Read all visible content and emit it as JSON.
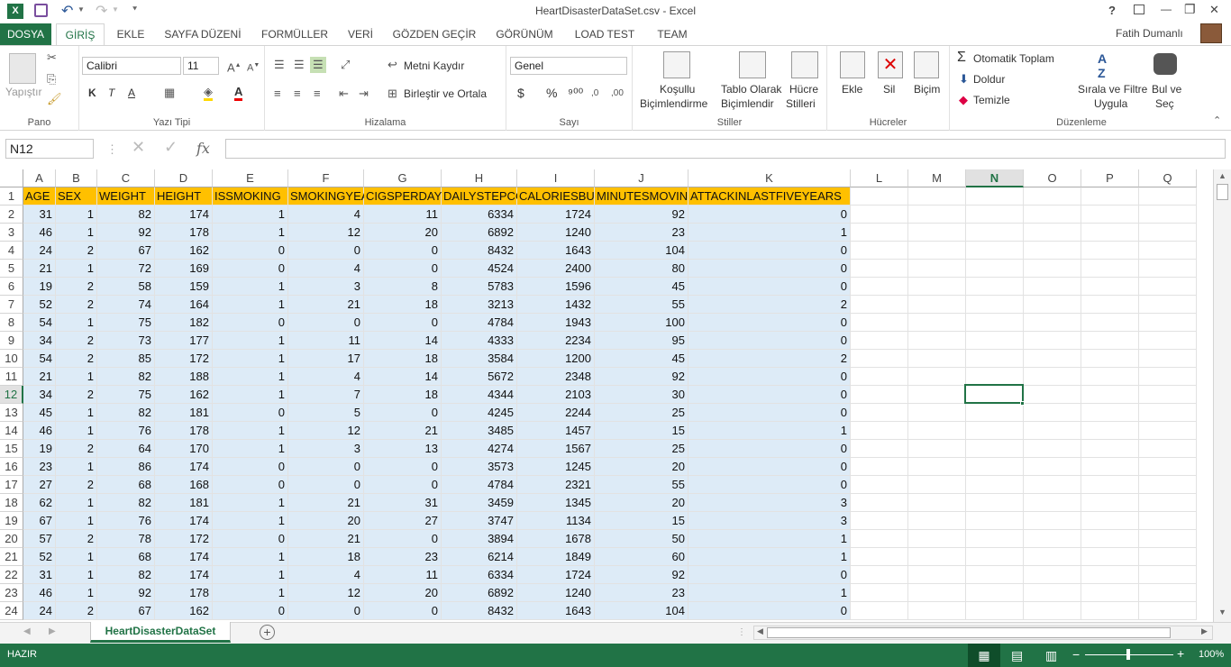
{
  "titlebar": {
    "title": "HeartDisasterDataSet.csv - Excel",
    "help": "?",
    "minimize": "—",
    "restore": "❐",
    "close": "✕"
  },
  "ribbon_tabs": [
    "DOSYA",
    "GİRİŞ",
    "EKLE",
    "SAYFA DÜZENİ",
    "FORMÜLLER",
    "VERİ",
    "GÖZDEN GEÇİR",
    "GÖRÜNÜM",
    "LOAD TEST",
    "TEAM"
  ],
  "user": {
    "name": "Fatih Dumanlı"
  },
  "ribbon": {
    "clipboard": {
      "label": "Pano",
      "paste": "Yapıştır"
    },
    "font": {
      "label": "Yazı Tipi",
      "name": "Calibri",
      "size": "11",
      "bold": "K",
      "italic": "T",
      "underline": "A"
    },
    "alignment": {
      "label": "Hizalama",
      "wrap": "Metni Kaydır",
      "merge": "Birleştir ve Ortala"
    },
    "number": {
      "label": "Sayı",
      "format": "Genel",
      "currency": "$",
      "percent": "%",
      "comma": "⁹⁰⁰"
    },
    "styles": {
      "label": "Stiller",
      "cond1": "Koşullu",
      "cond2": "Biçimlendirme",
      "table1": "Tablo Olarak",
      "table2": "Biçimlendir",
      "cell1": "Hücre",
      "cell2": "Stilleri"
    },
    "cells": {
      "label": "Hücreler",
      "insert": "Ekle",
      "delete": "Sil",
      "format": "Biçim"
    },
    "editing": {
      "label": "Düzenleme",
      "autosum": "Otomatik Toplam",
      "fill": "Doldur",
      "clear": "Temizle",
      "sort1": "Sırala ve Filtre",
      "sort2": "Uygula",
      "find1": "Bul ve",
      "find2": "Seç"
    }
  },
  "formula_bar": {
    "name_box": "N12",
    "fx": "fx",
    "value": ""
  },
  "columns": [
    "A",
    "B",
    "C",
    "D",
    "E",
    "F",
    "G",
    "H",
    "I",
    "J",
    "K",
    "L",
    "M",
    "N",
    "O",
    "P",
    "Q"
  ],
  "selected_column": "N",
  "selected_row": "12",
  "headers": [
    "AGE",
    "SEX",
    "WEIGHT",
    "HEIGHT",
    "ISSMOKING",
    "SMOKINGYEA",
    "CIGSPERDAY",
    "DAILYSTEPCC",
    "CALORIESBUR",
    "MINUTESMOVIN",
    "ATTACKINLASTFIVEYEARS"
  ],
  "rows": [
    [
      "31",
      "1",
      "82",
      "174",
      "1",
      "4",
      "11",
      "6334",
      "1724",
      "92",
      "0"
    ],
    [
      "46",
      "1",
      "92",
      "178",
      "1",
      "12",
      "20",
      "6892",
      "1240",
      "23",
      "1"
    ],
    [
      "24",
      "2",
      "67",
      "162",
      "0",
      "0",
      "0",
      "8432",
      "1643",
      "104",
      "0"
    ],
    [
      "21",
      "1",
      "72",
      "169",
      "0",
      "4",
      "0",
      "4524",
      "2400",
      "80",
      "0"
    ],
    [
      "19",
      "2",
      "58",
      "159",
      "1",
      "3",
      "8",
      "5783",
      "1596",
      "45",
      "0"
    ],
    [
      "52",
      "2",
      "74",
      "164",
      "1",
      "21",
      "18",
      "3213",
      "1432",
      "55",
      "2"
    ],
    [
      "54",
      "1",
      "75",
      "182",
      "0",
      "0",
      "0",
      "4784",
      "1943",
      "100",
      "0"
    ],
    [
      "34",
      "2",
      "73",
      "177",
      "1",
      "11",
      "14",
      "4333",
      "2234",
      "95",
      "0"
    ],
    [
      "54",
      "2",
      "85",
      "172",
      "1",
      "17",
      "18",
      "3584",
      "1200",
      "45",
      "2"
    ],
    [
      "21",
      "1",
      "82",
      "188",
      "1",
      "4",
      "14",
      "5672",
      "2348",
      "92",
      "0"
    ],
    [
      "34",
      "2",
      "75",
      "162",
      "1",
      "7",
      "18",
      "4344",
      "2103",
      "30",
      "0"
    ],
    [
      "45",
      "1",
      "82",
      "181",
      "0",
      "5",
      "0",
      "4245",
      "2244",
      "25",
      "0"
    ],
    [
      "46",
      "1",
      "76",
      "178",
      "1",
      "12",
      "21",
      "3485",
      "1457",
      "15",
      "1"
    ],
    [
      "19",
      "2",
      "64",
      "170",
      "1",
      "3",
      "13",
      "4274",
      "1567",
      "25",
      "0"
    ],
    [
      "23",
      "1",
      "86",
      "174",
      "0",
      "0",
      "0",
      "3573",
      "1245",
      "20",
      "0"
    ],
    [
      "27",
      "2",
      "68",
      "168",
      "0",
      "0",
      "0",
      "4784",
      "2321",
      "55",
      "0"
    ],
    [
      "62",
      "1",
      "82",
      "181",
      "1",
      "21",
      "31",
      "3459",
      "1345",
      "20",
      "3"
    ],
    [
      "67",
      "1",
      "76",
      "174",
      "1",
      "20",
      "27",
      "3747",
      "1134",
      "15",
      "3"
    ],
    [
      "57",
      "2",
      "78",
      "172",
      "0",
      "21",
      "0",
      "3894",
      "1678",
      "50",
      "1"
    ],
    [
      "52",
      "1",
      "68",
      "174",
      "1",
      "18",
      "23",
      "6214",
      "1849",
      "60",
      "1"
    ],
    [
      "31",
      "1",
      "82",
      "174",
      "1",
      "4",
      "11",
      "6334",
      "1724",
      "92",
      "0"
    ],
    [
      "46",
      "1",
      "92",
      "178",
      "1",
      "12",
      "20",
      "6892",
      "1240",
      "23",
      "1"
    ],
    [
      "24",
      "2",
      "67",
      "162",
      "0",
      "0",
      "0",
      "8432",
      "1643",
      "104",
      "0"
    ]
  ],
  "sheet_tab": "HeartDisasterDataSet",
  "status": {
    "mode": "HAZIR",
    "zoom": "100%"
  },
  "colors": {
    "excel_green": "#217346",
    "header_fill": "#ffc000",
    "data_fill": "#ddebf7"
  }
}
